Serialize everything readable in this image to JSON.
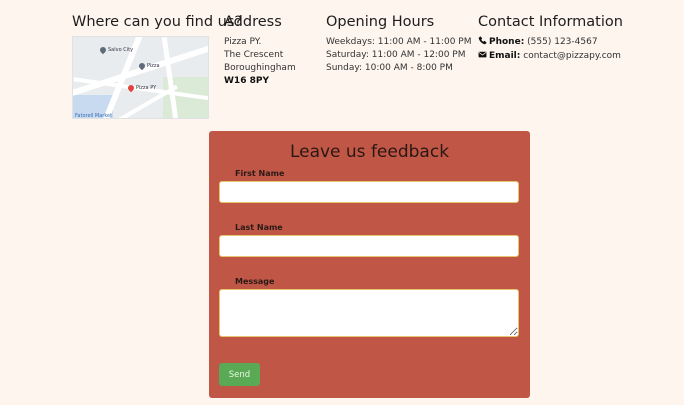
{
  "find": {
    "title": "Where can you find us?",
    "map": {
      "labels": [
        "Salvo City",
        "Pizza",
        "Pizza PY",
        "Fatorell Market"
      ]
    }
  },
  "address": {
    "title": "Address",
    "lines": [
      "Pizza PY.",
      "The Crescent",
      "Boroughingham"
    ],
    "postcode": "W16 8PY"
  },
  "hours": {
    "title": "Opening Hours",
    "lines": [
      "Weekdays: 11:00 AM - 11:00 PM",
      "Saturday: 11:00 AM - 12:00 PM",
      "Sunday: 10:00 AM - 8:00 PM"
    ]
  },
  "contact": {
    "title": "Contact Information",
    "phone_label": "Phone:",
    "phone_value": "(555) 123-4567",
    "email_label": "Email:",
    "email_value": "contact@pizzapy.com"
  },
  "feedback": {
    "title": "Leave us feedback",
    "first_name_label": "First Name",
    "first_name_value": "",
    "last_name_label": "Last Name",
    "last_name_value": "",
    "message_label": "Message",
    "message_value": "",
    "send_label": "Send"
  },
  "colors": {
    "background": "#fdf5ee",
    "form_bg": "#c05746",
    "input_border": "#e9c46a",
    "send_button": "#5aaa55"
  },
  "icons": {
    "phone": "phone-icon",
    "email": "envelope-icon",
    "map_pin": "map-pin-icon"
  }
}
